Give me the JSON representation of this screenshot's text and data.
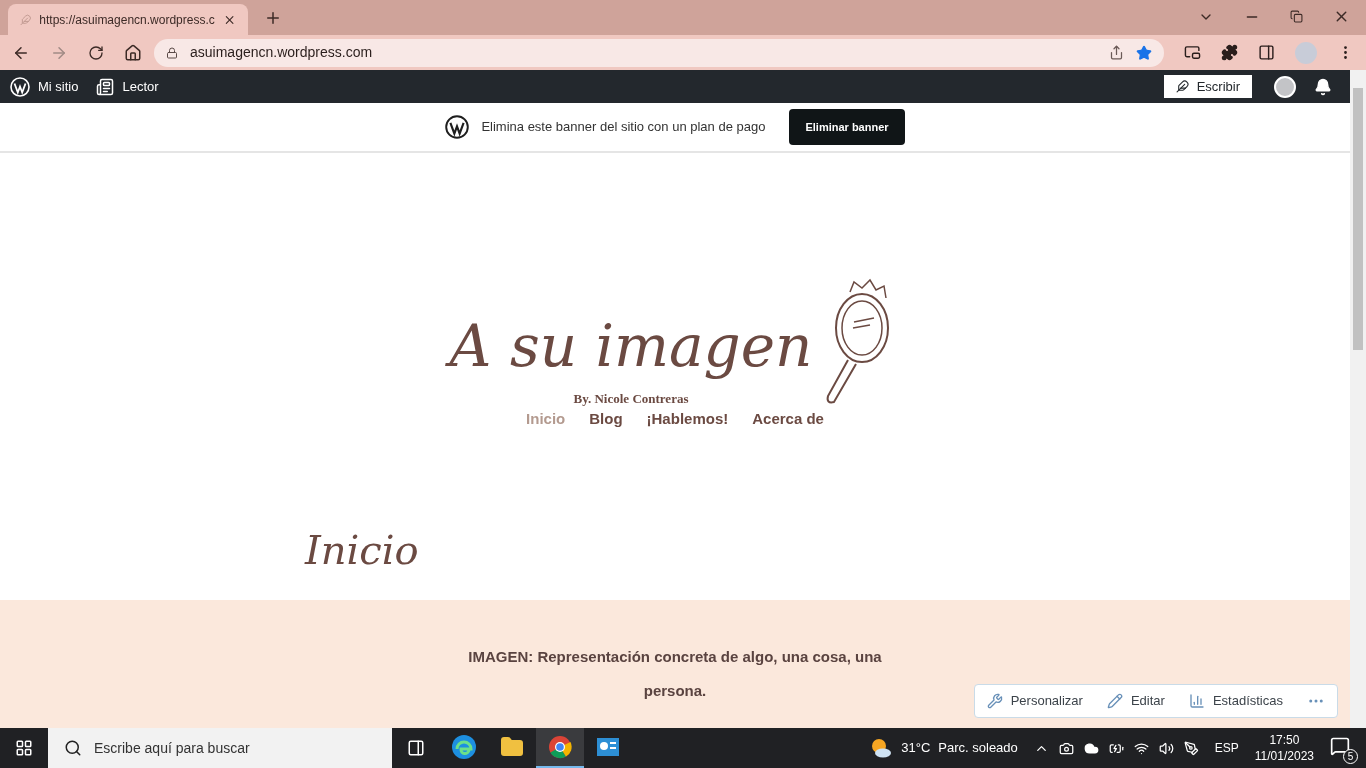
{
  "browser": {
    "tab_title": "https://asuimagencn.wordpress.c",
    "url": "asuimagencn.wordpress.com",
    "bookmarked": true
  },
  "admin_bar": {
    "items": [
      "Mi sitio",
      "Lector"
    ],
    "write_button": "Escribir"
  },
  "banner": {
    "text": "Elimina este banner del sitio con un plan de pago",
    "button": "Eliminar banner"
  },
  "logo": {
    "title": "A su imagen",
    "byline": "By. Nicole Contreras"
  },
  "nav": [
    {
      "label": "Inicio",
      "selected": true
    },
    {
      "label": "Blog",
      "selected": false
    },
    {
      "label": "¡Hablemos!",
      "selected": false
    },
    {
      "label": "Acerca de",
      "selected": false
    }
  ],
  "page_title": "Inicio",
  "intro": "IMAGEN: Representación concreta de algo, una cosa, una persona.",
  "action_bar": [
    "Personalizar",
    "Editar",
    "Estadísticas"
  ],
  "taskbar": {
    "search_placeholder": "Escribe aquí para buscar",
    "apps": [
      {
        "kind": "edge",
        "selected": false
      },
      {
        "kind": "files",
        "selected": false
      },
      {
        "kind": "chrome",
        "selected": true
      },
      {
        "kind": "monitor",
        "selected": false
      }
    ],
    "weather": "31°C",
    "weather_text": "Parc. soleado",
    "language": "ESP",
    "time": "17:50",
    "date": "11/01/2023",
    "notifications": "5"
  }
}
